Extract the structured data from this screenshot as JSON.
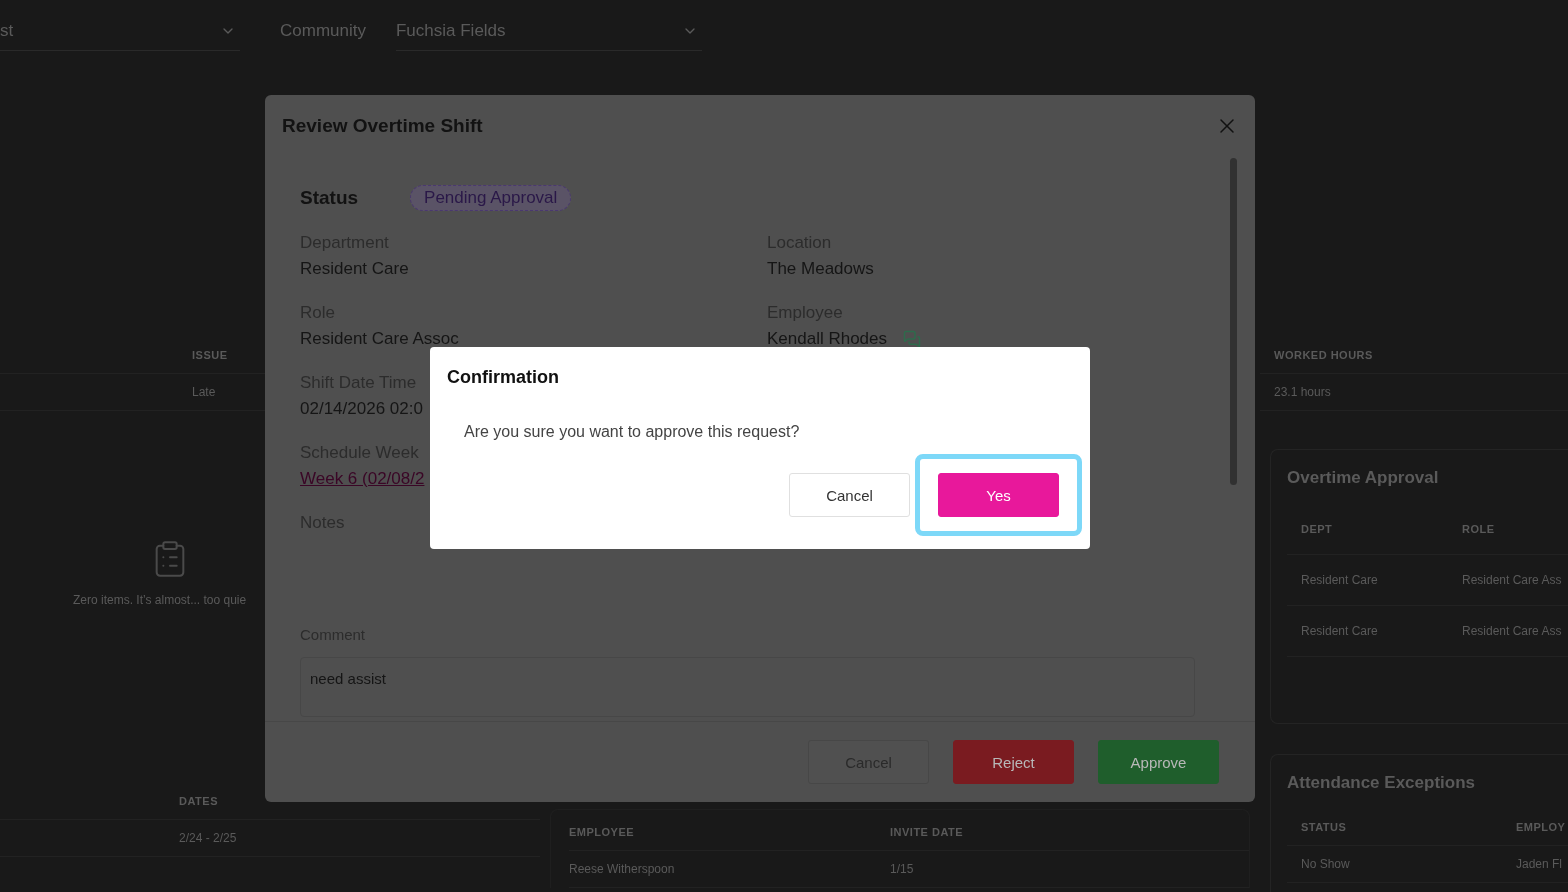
{
  "filters": {
    "first_select": {
      "value": "st"
    },
    "community": {
      "label": "Community",
      "value": "Fuchsia Fields"
    }
  },
  "issues_table": {
    "columns": [
      "ISSUE"
    ],
    "rows": [
      [
        "Late"
      ]
    ]
  },
  "empty_state": {
    "message": "Zero items. It’s almost... too quie"
  },
  "dates_table": {
    "columns": [
      "DATES"
    ],
    "rows": [
      [
        "2/24 - 2/25"
      ]
    ]
  },
  "invites_table": {
    "columns": [
      "EMPLOYEE",
      "INVITE DATE"
    ],
    "rows": [
      [
        "Reese Witherspoon",
        "1/15"
      ]
    ]
  },
  "hours_table": {
    "columns": [
      "WORKED HOURS"
    ],
    "rows": [
      [
        "23.1 hours"
      ]
    ]
  },
  "overtime_approval": {
    "title": "Overtime Approval",
    "columns": [
      "DEPT",
      "ROLE"
    ],
    "rows": [
      [
        "Resident Care",
        "Resident Care Ass"
      ],
      [
        "Resident Care",
        "Resident Care Ass"
      ]
    ]
  },
  "attendance_exceptions": {
    "title": "Attendance Exceptions",
    "columns": [
      "STATUS",
      "EMPLOY"
    ],
    "rows": [
      [
        "No Show",
        "Jaden Fl"
      ]
    ]
  },
  "review_dialog": {
    "title": "Review Overtime Shift",
    "status_label": "Status",
    "status": "Pending Approval",
    "left_fields": [
      {
        "label": "Department",
        "value": "Resident Care",
        "kind": "text"
      },
      {
        "label": "Role",
        "value": "Resident Care Assoc",
        "kind": "text"
      },
      {
        "label": "Shift Date Time",
        "value": "02/14/2026 02:0",
        "kind": "text"
      },
      {
        "label": "Schedule Week",
        "value": "Week 6 (02/08/2",
        "kind": "link"
      },
      {
        "label": "Notes",
        "kind": "text"
      }
    ],
    "right_fields": [
      {
        "label": "Location",
        "value": "The Meadows",
        "kind": "text"
      },
      {
        "label": "Employee",
        "value": "Kendall Rhodes",
        "kind": "message"
      }
    ],
    "comment": {
      "label": "Comment",
      "value": "need assist"
    },
    "buttons": [
      {
        "label": "Cancel",
        "kind": "secondary"
      },
      {
        "label": "Reject",
        "kind": "danger"
      },
      {
        "label": "Approve",
        "kind": "success"
      }
    ]
  },
  "confirmation": {
    "title": "Confirmation",
    "message": "Are you sure you want to approve this request?",
    "buttons": [
      {
        "label": "Cancel",
        "kind": "secondary",
        "focused": false
      },
      {
        "label": "Yes",
        "kind": "primary",
        "focused": true
      }
    ]
  }
}
